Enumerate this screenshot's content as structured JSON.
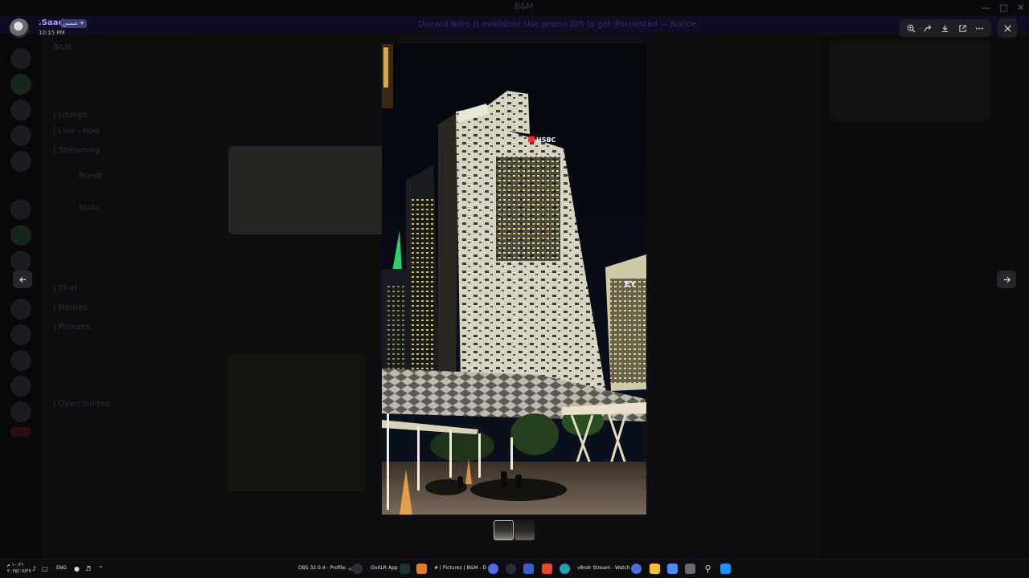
{
  "background_app": {
    "window_title": "B&M",
    "server_name": "B&M",
    "channels": [
      "| Lounge",
      "| Live - Now",
      "| Streaming",
      "Bondr",
      "Mollz",
      "| Chat",
      "| Memes",
      "| Pictures",
      "| Overcounted"
    ],
    "banner_text": "Discord Nitro is available! Use promo Gift to get discounted — Notice"
  },
  "viewer": {
    "user": {
      "name": ".Saad",
      "tag": "شمس ✈",
      "time": "10:15 PM"
    },
    "toolbar": {
      "zoom_icon": "zoom-in-icon",
      "forward_icon": "forward-icon",
      "download_icon": "download-icon",
      "open_icon": "open-in-browser-icon",
      "more_icon": "more-icon"
    },
    "close_icon": "close-icon",
    "prev_icon": "arrow-left-icon",
    "next_icon": "arrow-right-icon",
    "photo": {
      "sign_main": "HSBC",
      "sign_right": "EY"
    },
    "thumbnails": [
      {
        "selected": true
      },
      {
        "selected": false
      }
    ]
  },
  "taskbar": {
    "clock_time": "١٠:٢١ م",
    "clock_date": "٢٠٢٥/٠٧/٢٧",
    "language": "ENG",
    "apps": [
      {
        "label": "OBS 32.0.4 - Profile: بدون",
        "icon": "obs-icon"
      },
      {
        "label": "GoXLR App",
        "icon": "goxlr-icon"
      },
      {
        "label": "# | Pictures | B&M - D",
        "icon": "discord-icon"
      },
      {
        "label": "v8ndr Stream - Watch L",
        "icon": "edge-icon"
      }
    ],
    "colors": {
      "taskbar_bg": "#0d0d10",
      "accent_purple": "#b59cff",
      "windows_blue": "#1e90ff"
    }
  }
}
